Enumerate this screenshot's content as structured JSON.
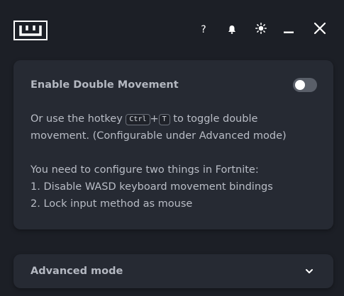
{
  "titlebar": {
    "logo_icon": "w-logo-icon",
    "help_label": "?",
    "icons": [
      "help-icon",
      "bell-icon",
      "sun-icon",
      "minimize-icon",
      "close-icon"
    ]
  },
  "double_movement": {
    "title": "Enable Double Movement",
    "toggle_enabled": false,
    "hotkey_prefix": "Or use the hotkey",
    "key_ctrl": "Ctrl",
    "plus": "+",
    "key_t": "T",
    "hotkey_suffix": "to toggle double",
    "line2": "movement. (Configurable under Advanced mode)",
    "config_intro": "You need to configure two things in Fortnite:",
    "step1": "1. Disable WASD keyboard movement bindings",
    "step2": "2. Lock input method as mouse"
  },
  "advanced": {
    "title": "Advanced mode",
    "expanded": false
  },
  "colors": {
    "background": "#1c1f26",
    "card": "#262a33",
    "toggle_off": "#5a5f69"
  }
}
